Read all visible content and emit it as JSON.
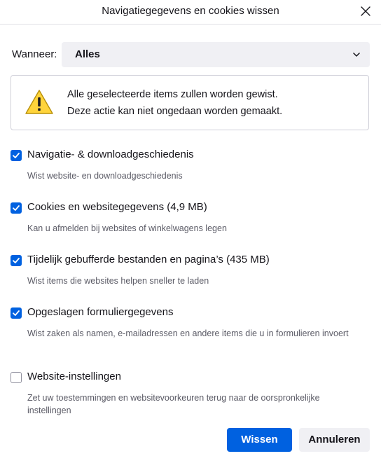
{
  "dialog": {
    "title": "Navigatiegegevens en cookies wissen",
    "close_icon": "close-icon"
  },
  "when": {
    "label": "Wanneer:",
    "selected": "Alles",
    "icon": "chevron-down-icon"
  },
  "warning": {
    "icon": "warning-icon",
    "line1": "Alle geselecteerde items zullen worden gewist.",
    "line2": "Deze actie kan niet ongedaan worden gemaakt."
  },
  "items": [
    {
      "label": "Navigatie- & downloadgeschiedenis",
      "description": "Wist website- en downloadgeschiedenis",
      "checked": true
    },
    {
      "label": "Cookies en websitegegevens (4,9 MB)",
      "description": "Kan u afmelden bij websites of winkelwagens legen",
      "checked": true
    },
    {
      "label": "Tijdelijk gebufferde bestanden en pagina’s (435 MB)",
      "description": "Wist items die websites helpen sneller te laden",
      "checked": true
    },
    {
      "label": "Opgeslagen formuliergegevens",
      "description": "Wist zaken als namen, e-mailadressen en andere items die u in formulieren invoert",
      "checked": true
    },
    {
      "label": "Website-instellingen",
      "description": "Zet uw toestemmingen en websitevoorkeuren terug naar de oorspronkelijke instellingen",
      "checked": false
    }
  ],
  "buttons": {
    "confirm": "Wissen",
    "cancel": "Annuleren"
  },
  "colors": {
    "accent": "#0061e0",
    "button_secondary": "#f0f0f4",
    "warning_yellow": "#ffd43b"
  }
}
